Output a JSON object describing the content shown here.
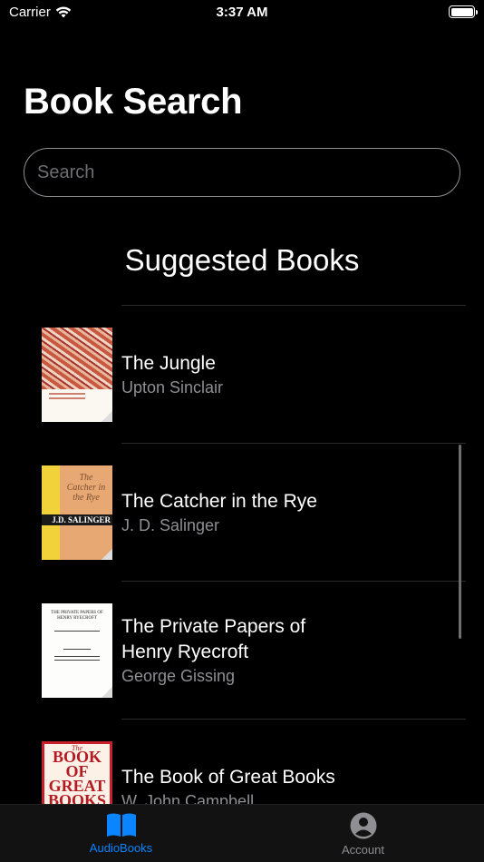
{
  "status_bar": {
    "carrier": "Carrier",
    "time": "3:37 AM"
  },
  "header": {
    "title": "Book Search"
  },
  "search": {
    "placeholder": "Search",
    "value": ""
  },
  "section": {
    "title": "Suggested Books"
  },
  "books": [
    {
      "title": "The Jungle",
      "author": "Upton Sinclair",
      "cover_icon": "book-cover-image"
    },
    {
      "title": "The Catcher in the Rye",
      "author": "J. D. Salinger",
      "cover_icon": "book-cover-image"
    },
    {
      "title": "The Private Papers of Henry Ryecroft",
      "author": "George Gissing",
      "cover_icon": "book-cover-image"
    },
    {
      "title": "The Book of Great Books",
      "author": "W. John Campbell",
      "cover_icon": "book-cover-image"
    }
  ],
  "covers": {
    "catcher_band": "J.D. SALINGER",
    "catcher_script": "The Catcher in the Rye",
    "ryecroft_text": "THE PRIVATE PAPERS OF HENRY RYECROFT",
    "books_big": "BOOK OF GREAT BOOKS",
    "books_small": "The"
  },
  "tab_bar": {
    "tabs": [
      {
        "label": "AudioBooks",
        "icon": "book-open-icon",
        "active": true
      },
      {
        "label": "Account",
        "icon": "person-circle-icon",
        "active": false
      }
    ]
  },
  "colors": {
    "accent": "#0a84ff",
    "background": "#000000",
    "secondary_text": "#8e8e93"
  }
}
